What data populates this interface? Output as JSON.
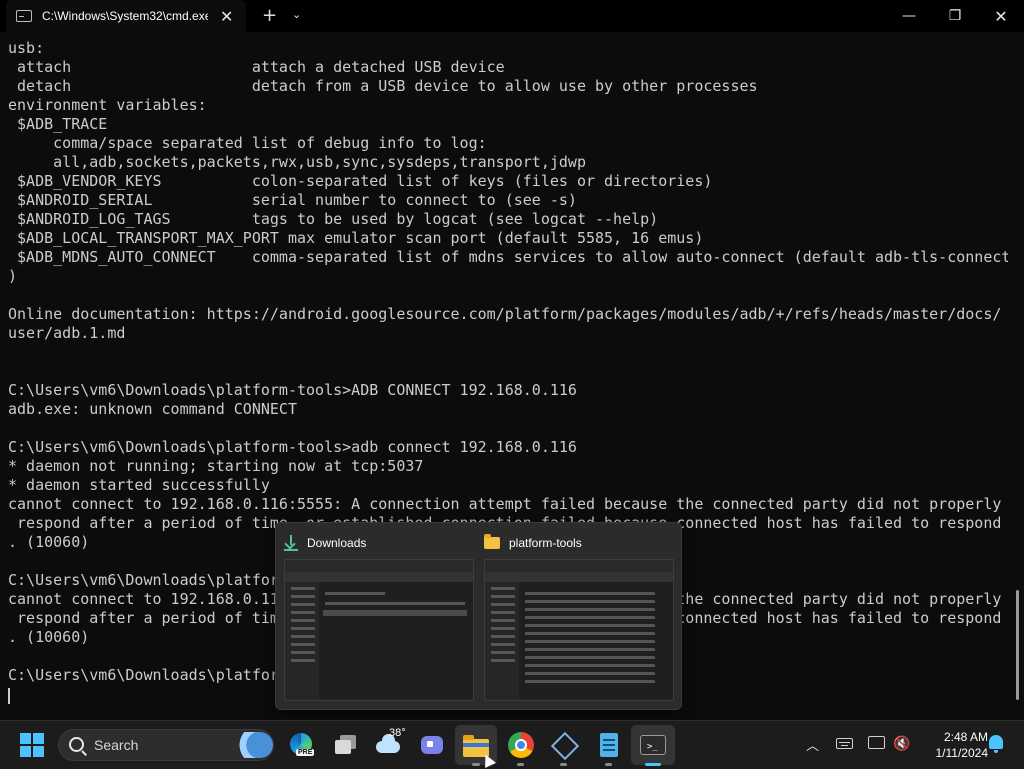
{
  "window": {
    "tab_title": "C:\\Windows\\System32\\cmd.exe",
    "tab_close": "✕",
    "new_tab": "+",
    "dropdown": "⌄",
    "minimize": "—",
    "maximize": "❐",
    "close": "✕"
  },
  "terminal": {
    "lines": [
      "usb:",
      " attach                    attach a detached USB device",
      " detach                    detach from a USB device to allow use by other processes",
      "environment variables:",
      " $ADB_TRACE",
      "     comma/space separated list of debug info to log:",
      "     all,adb,sockets,packets,rwx,usb,sync,sysdeps,transport,jdwp",
      " $ADB_VENDOR_KEYS          colon-separated list of keys (files or directories)",
      " $ANDROID_SERIAL           serial number to connect to (see -s)",
      " $ANDROID_LOG_TAGS         tags to be used by logcat (see logcat --help)",
      " $ADB_LOCAL_TRANSPORT_MAX_PORT max emulator scan port (default 5585, 16 emus)",
      " $ADB_MDNS_AUTO_CONNECT    comma-separated list of mdns services to allow auto-connect (default adb-tls-connect",
      ")",
      "",
      "Online documentation: https://android.googlesource.com/platform/packages/modules/adb/+/refs/heads/master/docs/",
      "user/adb.1.md",
      "",
      "",
      "C:\\Users\\vm6\\Downloads\\platform-tools>ADB CONNECT 192.168.0.116",
      "adb.exe: unknown command CONNECT",
      "",
      "C:\\Users\\vm6\\Downloads\\platform-tools>adb connect 192.168.0.116",
      "* daemon not running; starting now at tcp:5037",
      "* daemon started successfully",
      "cannot connect to 192.168.0.116:5555: A connection attempt failed because the connected party did not properly",
      " respond after a period of time, or established connection failed because connected host has failed to respond",
      ". (10060)",
      "",
      "C:\\Users\\vm6\\Downloads\\platform-tools>adb connect 192.168.0.116",
      "cannot connect to 192.168.0.116:5555: A connection attempt failed because the connected party did not properly",
      " respond after a period of time, or established connection failed because connected host has failed to respond",
      ". (10060)",
      "",
      "C:\\Users\\vm6\\Downloads\\platform-tools>"
    ]
  },
  "flyout": {
    "thumbnails": [
      {
        "label": "Downloads",
        "icon": "download-icon"
      },
      {
        "label": "platform-tools",
        "icon": "folder-icon"
      }
    ]
  },
  "taskbar": {
    "search_label": "Search",
    "edge_badge": "PRE",
    "weather_temp": "38°",
    "tray_chevron": "︿",
    "volume_glyph": "🔇",
    "time": "2:48 AM",
    "date": "1/11/2024",
    "accent": "#4cc2ff"
  }
}
